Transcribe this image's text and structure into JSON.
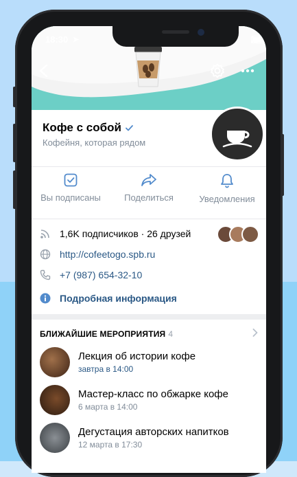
{
  "status_bar": {
    "time": "18:30"
  },
  "community": {
    "name": "Кофе с собой",
    "subtitle": "Кофейня, которая рядом",
    "verified": true
  },
  "actions": [
    {
      "label": "Вы подписаны",
      "icon": "checkbox-icon"
    },
    {
      "label": "Поделиться",
      "icon": "share-icon"
    },
    {
      "label": "Уведомления",
      "icon": "bell-icon"
    }
  ],
  "info": {
    "followers": "1,6K подписчиков · 26 друзей",
    "website": "http://cofeetogo.spb.ru",
    "phone": "+7 (987) 654-32-10",
    "more": "Подробная информация"
  },
  "events": {
    "title": "БЛИЖАЙШИЕ МЕРОПРИЯТИЯ",
    "count": "4",
    "items": [
      {
        "title": "Лекция об истории кофе",
        "date": "завтра в 14:00"
      },
      {
        "title": "Мастер-класс по обжарке кофе",
        "date": "6 марта в 14:00"
      },
      {
        "title": "Дегустация авторских напитков",
        "date": "12 марта в 17:30"
      }
    ]
  },
  "colors": {
    "accent": "#2a5885",
    "cover": "#6ccfc6",
    "icon": "#528bcc",
    "muted": "#818c99"
  }
}
